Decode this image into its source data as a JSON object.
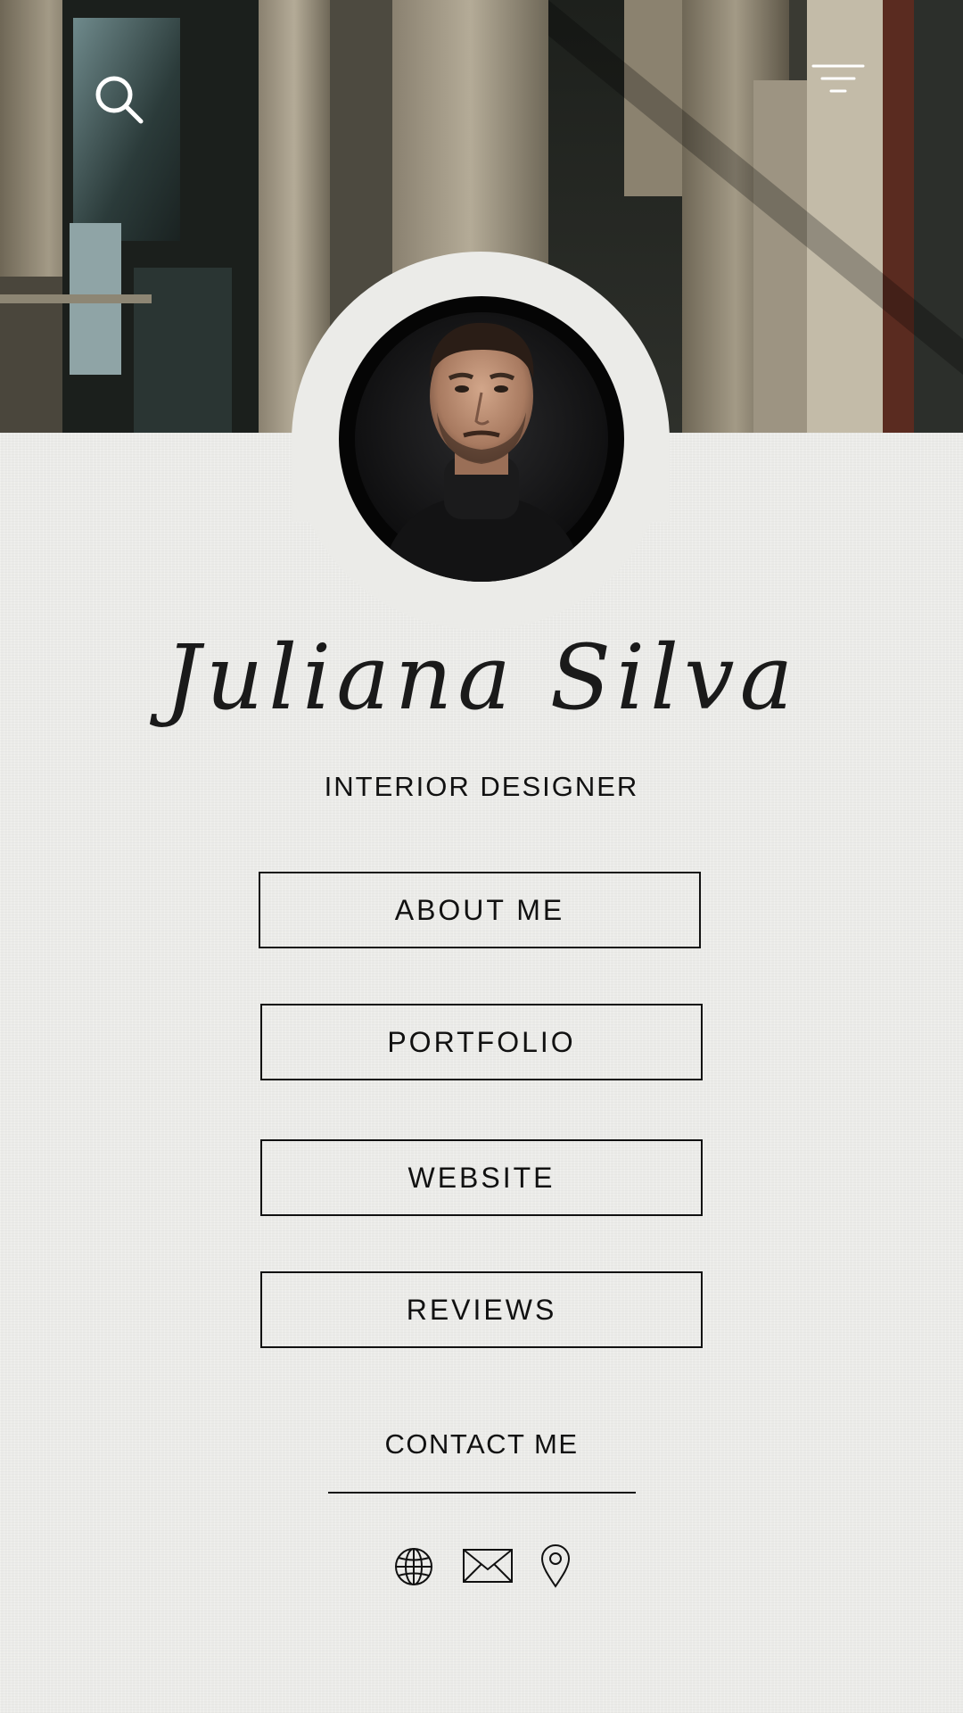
{
  "profile": {
    "name": "Juliana Silva",
    "role": "INTERIOR DESIGNER"
  },
  "links": [
    {
      "label": "ABOUT ME"
    },
    {
      "label": "PORTFOLIO"
    },
    {
      "label": "WEBSITE"
    },
    {
      "label": "REVIEWS"
    }
  ],
  "contact": {
    "label": "CONTACT ME"
  },
  "icons": {
    "search": "search-icon",
    "menu": "menu-icon",
    "globe": "globe-icon",
    "mail": "mail-icon",
    "location": "location-pin-icon"
  },
  "colors": {
    "background": "#ebebe8",
    "text": "#111111",
    "header_icons": "#ffffff"
  }
}
